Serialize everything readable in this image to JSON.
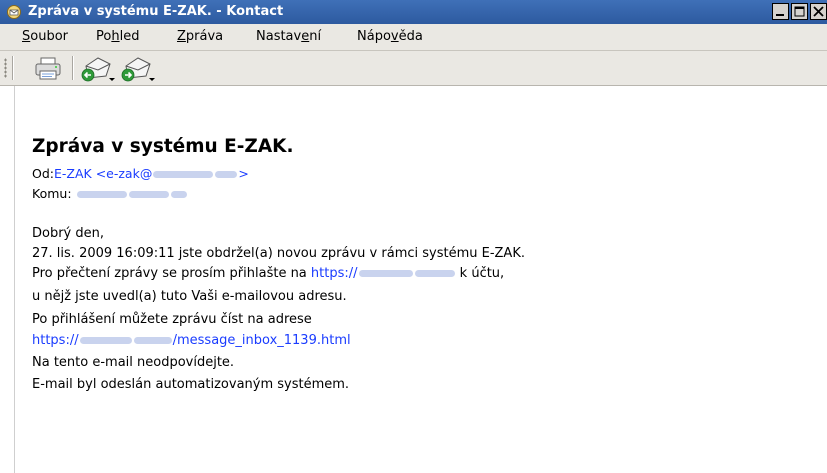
{
  "window": {
    "title": "Zpráva v systému E-ZAK. - Kontact",
    "minimize_label": "minimize",
    "maximize_label": "maximize",
    "close_label": "close"
  },
  "menu": {
    "items": [
      {
        "label": "Soubor",
        "mnemonic": "S",
        "rest": "oubor"
      },
      {
        "label": "Pohled",
        "pre": "Po",
        "mnemonic": "h",
        "rest": "led"
      },
      {
        "label": "Zpráva",
        "mnemonic": "Z",
        "rest": "práva"
      },
      {
        "label": "Nastavení",
        "pre": "Nastav",
        "mnemonic": "e",
        "rest": "ní"
      },
      {
        "label": "Nápověda",
        "pre": "Nápo",
        "mnemonic": "v",
        "rest": "ěda"
      }
    ]
  },
  "message": {
    "subject": "Zpráva v systému E-ZAK.",
    "from_label": "Od:",
    "from_name": "E-ZAK <e-zak@",
    "from_end": ">",
    "to_label": "Komu:",
    "greeting": "Dobrý den,",
    "line1": "27. lis. 2009 16:09:11 jste obdržel(a) novou zprávu v rámci systému E-ZAK.",
    "line2_pre": "Pro přečtení zprávy se prosím přihlašte na ",
    "line2_link": "https://",
    "line2_post": " k účtu,",
    "line3": "u nějž jste uvedl(a) tuto Vaši e-mailovou adresu.",
    "line4": "Po přihlášení můžete zprávu číst na adrese",
    "line5_link_start": "https://",
    "line5_link_end": "/message_inbox_1139.html",
    "line6": "Na tento e-mail neodpovídejte.",
    "line7": "E-mail byl odeslán automatizovaným systémem."
  },
  "colors": {
    "titlebar": "#2d5aa0",
    "link": "#1a3cff",
    "chrome": "#eae8e3"
  },
  "icons": [
    "app-icon",
    "print-icon",
    "previous-message-icon",
    "next-message-icon"
  ]
}
